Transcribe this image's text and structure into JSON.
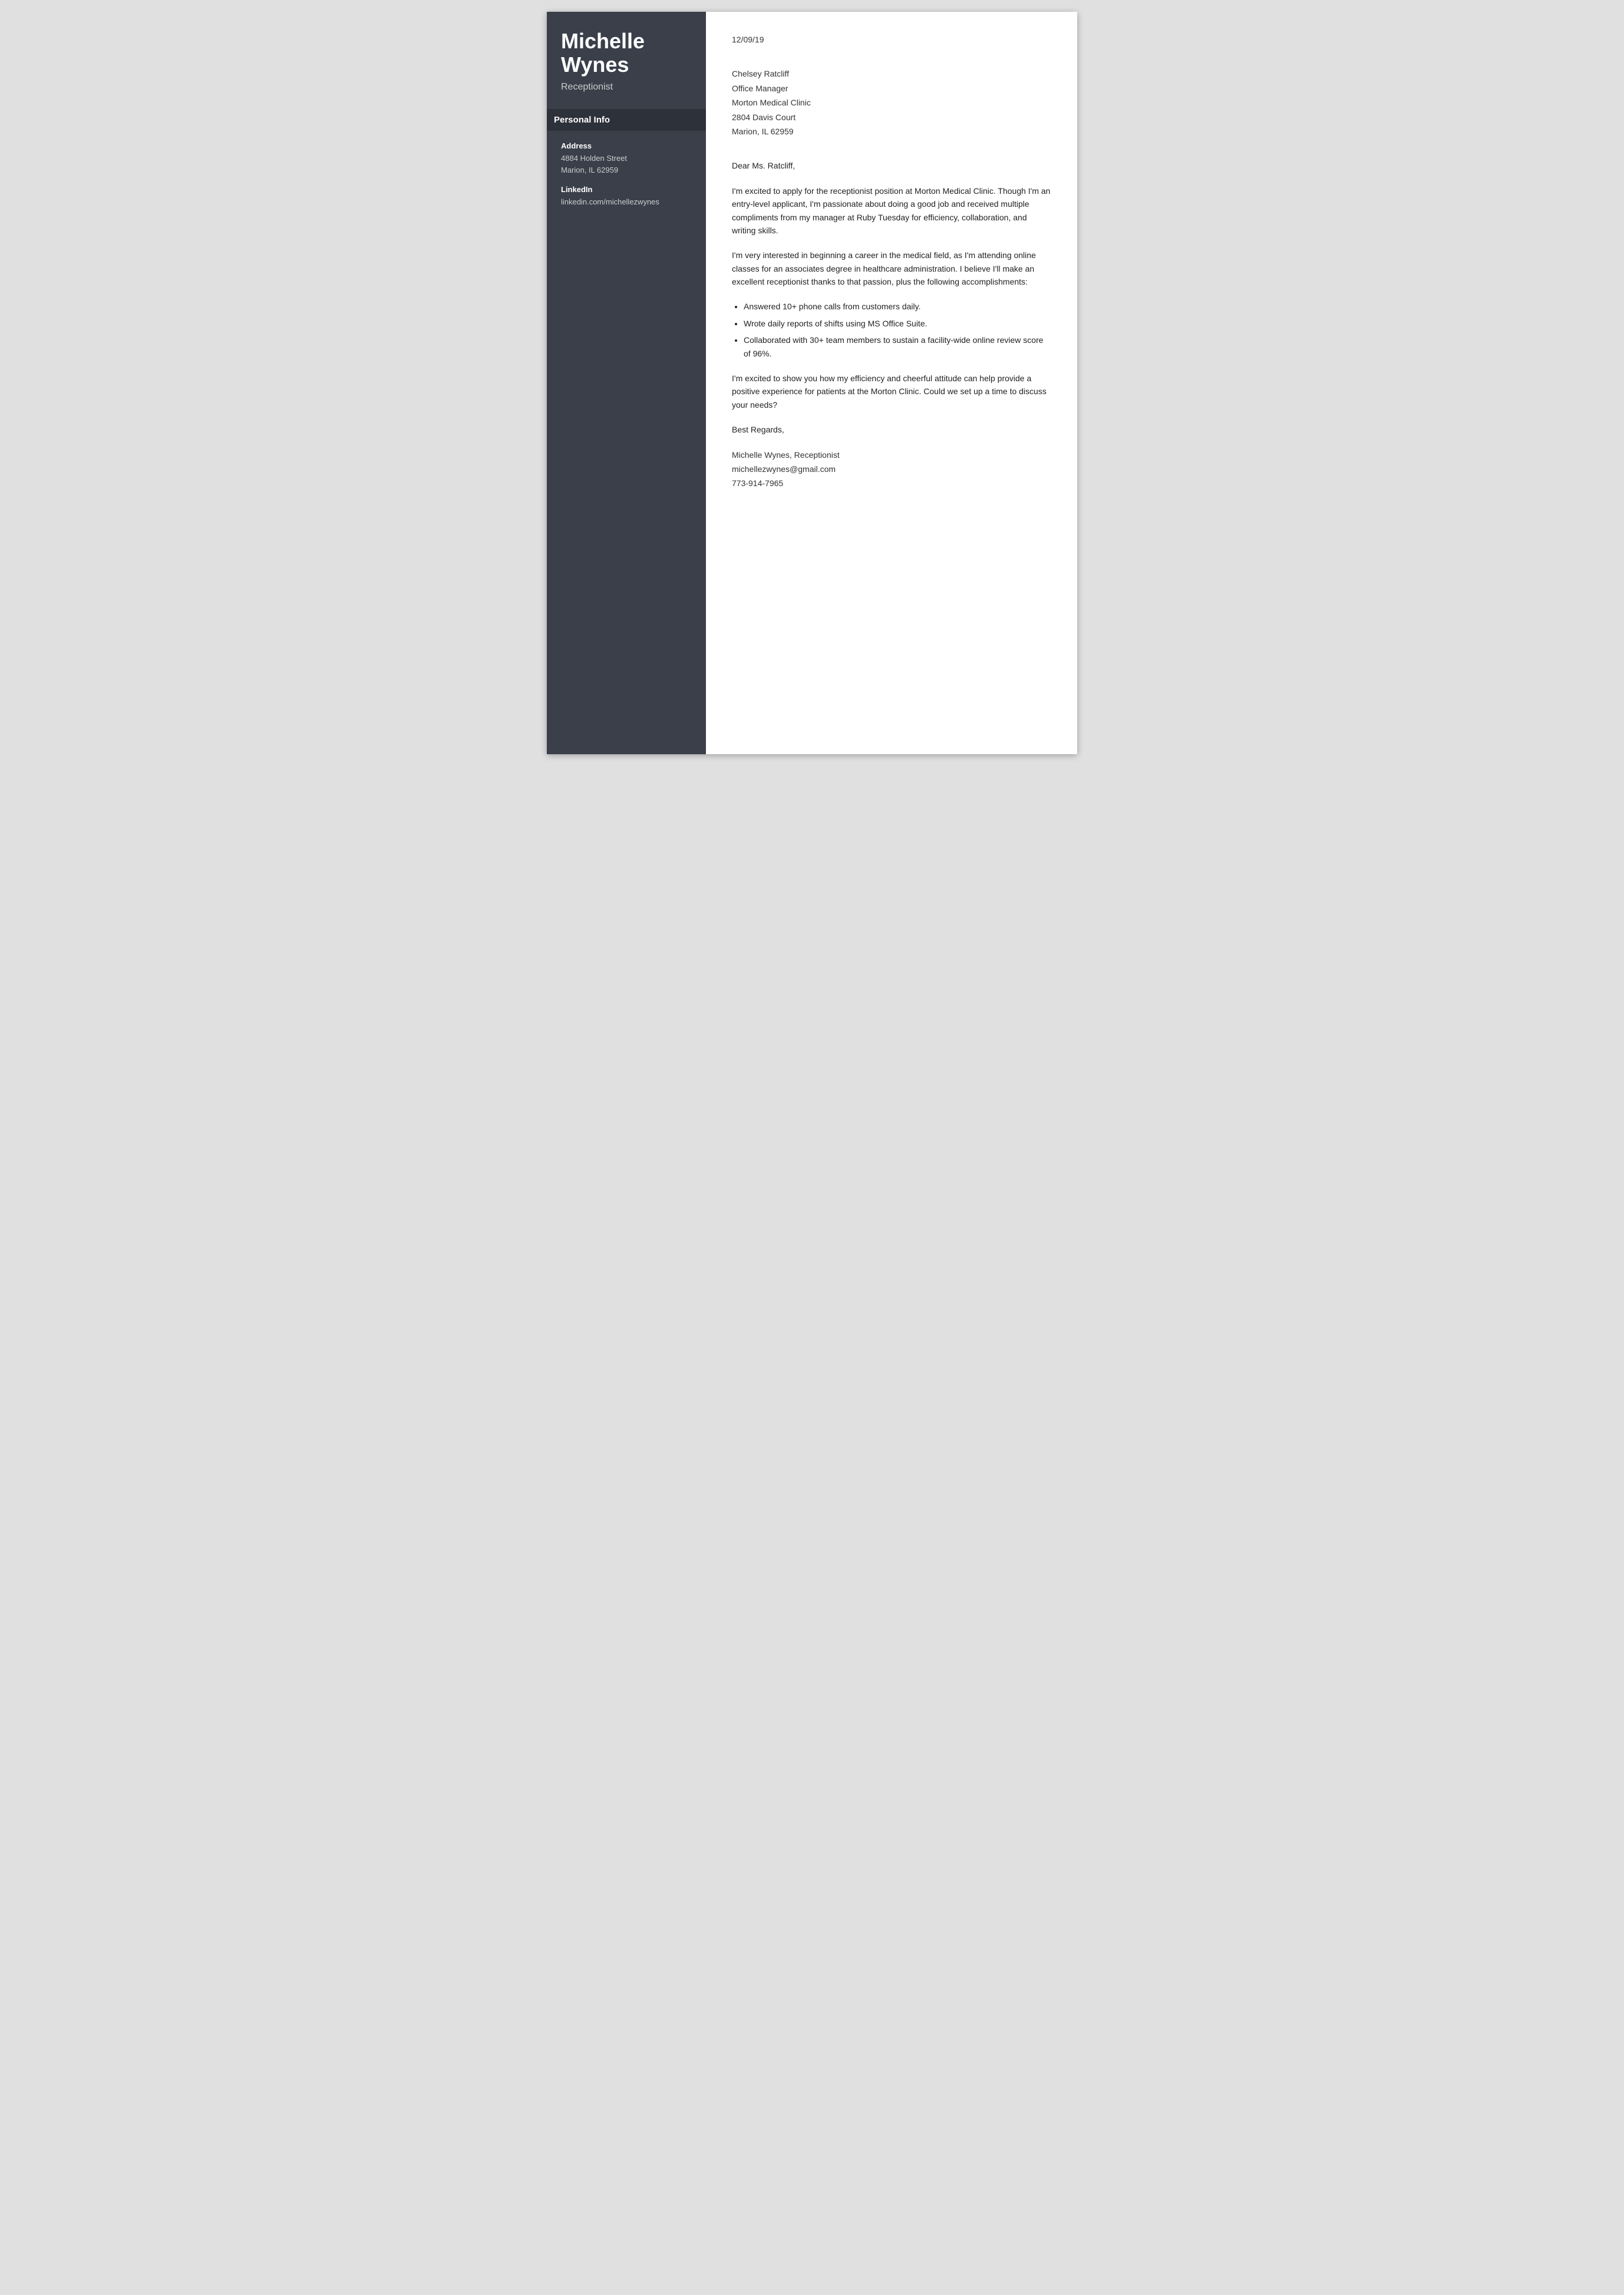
{
  "sidebar": {
    "name_line1": "Michelle",
    "name_line2": "Wynes",
    "job_title": "Receptionist",
    "personal_info_header": "Personal Info",
    "address_label": "Address",
    "address_line1": "4884 Holden Street",
    "address_line2": "Marion, IL 62959",
    "linkedin_label": "LinkedIn",
    "linkedin_value": "linkedin.com/michellezwynes"
  },
  "main": {
    "date": "12/09/19",
    "recipient_name": "Chelsey Ratcliff",
    "recipient_title": "Office Manager",
    "recipient_company": "Morton Medical Clinic",
    "recipient_address": "2804 Davis Court",
    "recipient_city": "Marion, IL 62959",
    "salutation": "Dear Ms. Ratcliff,",
    "paragraph1": "I'm excited to apply for the receptionist position at Morton Medical Clinic. Though I'm an entry-level applicant, I'm passionate about doing a good job and received multiple compliments from my manager at Ruby Tuesday for efficiency, collaboration, and writing skills.",
    "paragraph2": "I'm very interested in beginning a career in the medical field, as I'm attending online classes for an associates degree in healthcare administration. I believe I'll make an excellent receptionist thanks to that passion, plus the following accomplishments:",
    "bullets": [
      "Answered 10+ phone calls from customers daily.",
      "Wrote daily reports of shifts using MS Office Suite.",
      "Collaborated with 30+ team members to sustain a facility-wide online review score of 96%."
    ],
    "paragraph3": "I'm excited to show you how my efficiency and cheerful attitude can help provide a positive experience for patients at the Morton Clinic. Could we set up a time to discuss your needs?",
    "closing": "Best Regards,",
    "signature_name": "Michelle Wynes, Receptionist",
    "signature_email": "michellezwynes@gmail.com",
    "signature_phone": "773-914-7965"
  }
}
